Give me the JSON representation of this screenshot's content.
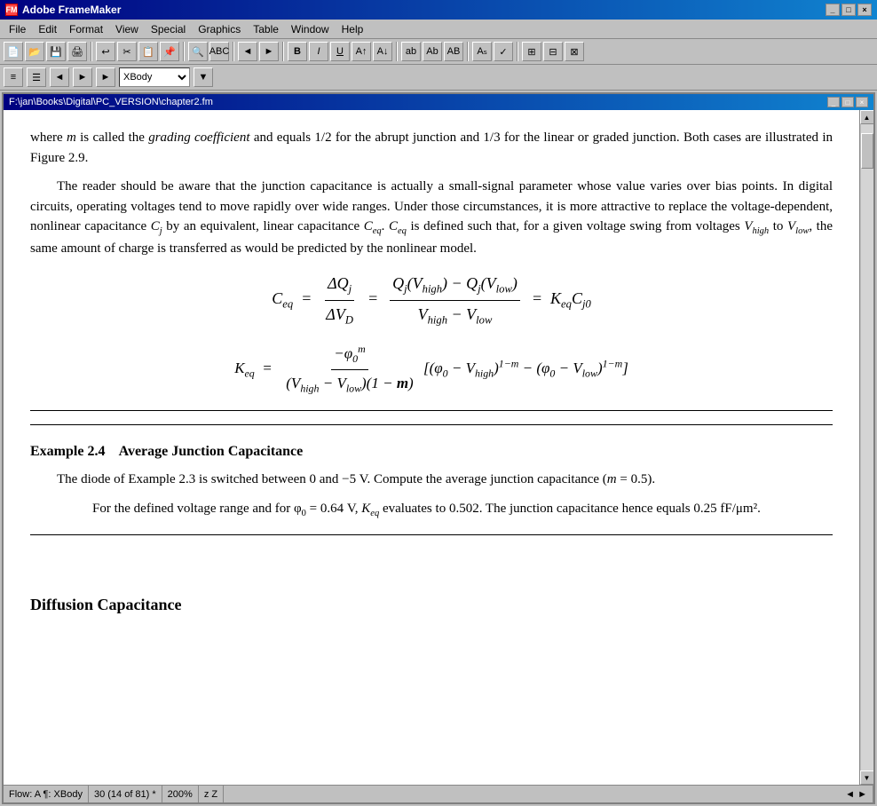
{
  "app": {
    "title": "Adobe FrameMaker",
    "icon": "FM"
  },
  "menu": {
    "items": [
      "File",
      "Edit",
      "Format",
      "View",
      "Special",
      "Graphics",
      "Table",
      "Window",
      "Help"
    ]
  },
  "toolbar": {
    "dropdown_value": "XBody"
  },
  "document": {
    "title": "F:\\jan\\Books\\Digital\\PC_VERSION\\chapter2.fm",
    "content": {
      "intro_text_1": "where ",
      "intro_m": "m",
      "intro_text_2": " is called the ",
      "intro_gc": "grading coefficient",
      "intro_text_3": " and equals 1/2 for the abrupt junction and 1/3 for the linear or graded junction. Both cases are illustrated in Figure 2.9.",
      "para1": "The reader should be aware that the junction capacitance is actually a small-signal parameter whose value varies over bias points. In digital circuits, operating voltages tend to move rapidly over wide ranges. Under those circumstances, it is more attractive to replace the voltage-dependent, nonlinear capacitance C",
      "para1_sub1": "j",
      "para1_cont": " by an equivalent, linear capacitance C",
      "para1_sub2": "eq",
      "para1_cont2": ". C",
      "para1_sub3": "eq",
      "para1_cont3": " is defined such that, for a given voltage swing from voltages V",
      "para1_sub4": "high",
      "para1_cont4": " to V",
      "para1_sub5": "low",
      "para1_cont5": ", the same amount of charge is transferred as would be predicted by the nonlinear model.",
      "example_heading": "Example 2.4",
      "example_title": "Average Junction Capacitance",
      "example_text": "The diode of Example 2.3 is switched between 0 and −5 V. Compute the average junction capacitance (m = 0.5).",
      "example_solution": "For the defined voltage range and for φ",
      "example_sol_sub": "0",
      "example_sol_cont": " = 0.64 V, K",
      "example_sol_sub2": "eq",
      "example_sol_cont2": " evaluates to 0.502. The junction capacitance hence equals 0.25 fF/μm².",
      "section_heading": "Diffusion Capacitance"
    }
  },
  "status": {
    "flow": "Flow: A  ¶: XBody",
    "page": "30 (14 of 81) *",
    "zoom": "200%",
    "indicators": "z Z"
  }
}
